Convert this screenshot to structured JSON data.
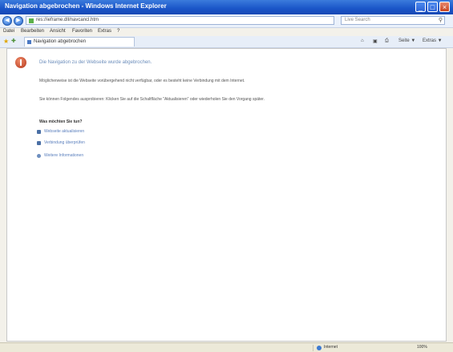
{
  "window": {
    "title": "Navigation abgebrochen - Windows Internet Explorer",
    "controls": {
      "minimize": "_",
      "maximize": "□",
      "close": "×"
    }
  },
  "nav": {
    "back": "◀",
    "forward": "▶",
    "address": "res://ieframe.dll/navcancl.htm",
    "search_placeholder": "Live Search",
    "search_icon": "magnifier-icon"
  },
  "menu": {
    "items": [
      "Datei",
      "Bearbeiten",
      "Ansicht",
      "Favoriten",
      "Extras",
      "?"
    ]
  },
  "tab": {
    "label": "Navigation abgebrochen"
  },
  "commandbar": {
    "page": "Seite ▼",
    "tools": "Extras ▼"
  },
  "content": {
    "heading": "Die Navigation zu der Webseite wurde abgebrochen.",
    "para1": "Möglicherweise ist die Webseite vorübergehend nicht verfügbar, oder es besteht keine Verbindung mit dem Internet.",
    "para2": "Sie können Folgendes ausprobieren: Klicken Sie auf die Schaltfläche \"Aktualisieren\" oder wiederholen Sie den Vorgang später.",
    "subhead": "Was möchten Sie tun?",
    "options": [
      "Webseite aktualisieren",
      "Verbindung überprüfen",
      "Weitere Informationen"
    ]
  },
  "status": {
    "zone": "Internet",
    "zoom": "100%"
  },
  "colors": {
    "titlebar": "#1a55c8",
    "link": "#5a7fbd",
    "heading": "#6b8dbb",
    "error_icon": "#b3361b"
  }
}
